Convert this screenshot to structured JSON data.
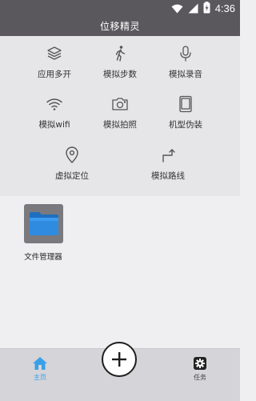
{
  "status_bar": {
    "time": "4:36",
    "icons": [
      "wifi-icon",
      "signal-icon",
      "battery-icon"
    ]
  },
  "header": {
    "title": "位移精灵"
  },
  "features": [
    {
      "label": "应用多开",
      "icon": "layers-icon"
    },
    {
      "label": "模拟步数",
      "icon": "walking-icon"
    },
    {
      "label": "模拟录音",
      "icon": "microphone-icon"
    },
    {
      "label": "模拟wifi",
      "icon": "wifi-icon"
    },
    {
      "label": "模拟拍照",
      "icon": "camera-icon"
    },
    {
      "label": "机型伪装",
      "icon": "tablet-icon"
    },
    {
      "label": "虚拟定位",
      "icon": "location-pin-icon"
    },
    {
      "label": "模拟路线",
      "icon": "route-arrow-icon"
    }
  ],
  "apps": [
    {
      "label": "文件管理器",
      "icon": "folder-icon"
    }
  ],
  "bottom_nav": {
    "home_label": "主页",
    "task_label": "任务",
    "add_icon": "plus-icon"
  },
  "colors": {
    "header_bg": "#5a585d",
    "panel_bg": "#e6e5e8",
    "page_bg": "#efeef1",
    "nav_bg": "#d5d4d8",
    "accent": "#3ba0e8",
    "folder": "#2e8be0"
  }
}
